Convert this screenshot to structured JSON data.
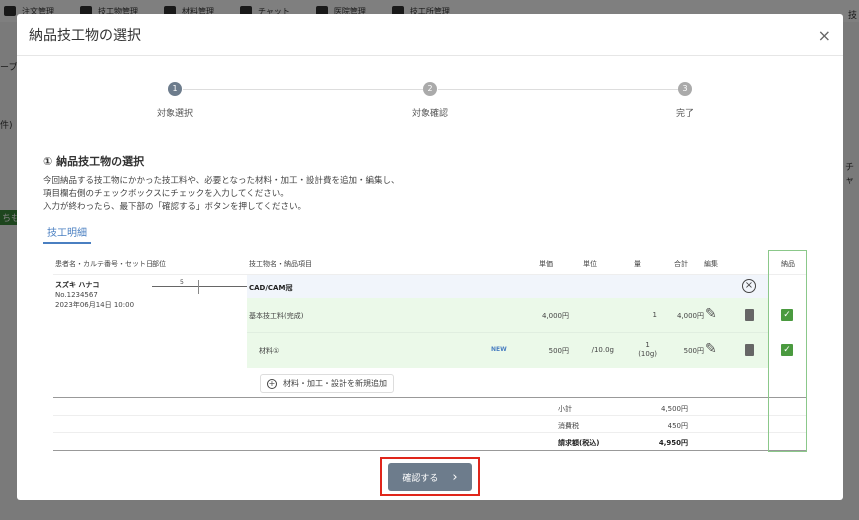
{
  "background": {
    "nav": [
      "注文管理",
      "技工物管理",
      "材料管理",
      "チャット",
      "医院管理",
      "技工所管理"
    ],
    "fragments": [
      "ープ",
      "件)",
      "ちも",
      "技",
      "チャ"
    ]
  },
  "modal": {
    "title": "納品技工物の選択",
    "close": "×"
  },
  "steps": [
    {
      "num": "1",
      "label": "対象選択"
    },
    {
      "num": "2",
      "label": "対象確認"
    },
    {
      "num": "3",
      "label": "完了"
    }
  ],
  "section": {
    "title": "① 納品技工物の選択",
    "desc": [
      "今回納品する技工物にかかった技工料や、必要となった材料・加工・設計費を追加・編集し、",
      "項目欄右側のチェックボックスにチェックを入力してください。",
      "入力が終わったら、最下部の「確認する」ボタンを押してください。"
    ]
  },
  "tab": "技工明細",
  "table": {
    "headers": {
      "patient": "患者名・カルテ番号・セット日",
      "part": "部位",
      "item": "技工物名・納品項目",
      "price": "単価",
      "unit": "単位",
      "qty": "量",
      "total": "合計",
      "edit": "編集",
      "deliver": "納品"
    },
    "patient": {
      "name": "スズキ ハナコ",
      "no": "No.1234567",
      "date": "2023年06月14日 10:00"
    },
    "tooth": "5",
    "product": "CAD/CAM冠",
    "rows": [
      {
        "name": "基本技工料(完成)",
        "badge": "",
        "price": "4,000円",
        "unit": "",
        "qty": "1",
        "qty2": "",
        "total": "4,000円",
        "checked": true
      },
      {
        "name": "材料①",
        "badge": "NEW",
        "price": "500円",
        "unit": "/10.0g",
        "qty": "1",
        "qty2": "(10g)",
        "total": "500円",
        "checked": true
      }
    ],
    "add": "材料・加工・設計を新規追加",
    "summary": [
      {
        "label": "小計",
        "value": "4,500円"
      },
      {
        "label": "消費税",
        "value": "450円"
      },
      {
        "label": "請求額(税込)",
        "value": "4,950円"
      }
    ]
  },
  "confirm": "確認する"
}
